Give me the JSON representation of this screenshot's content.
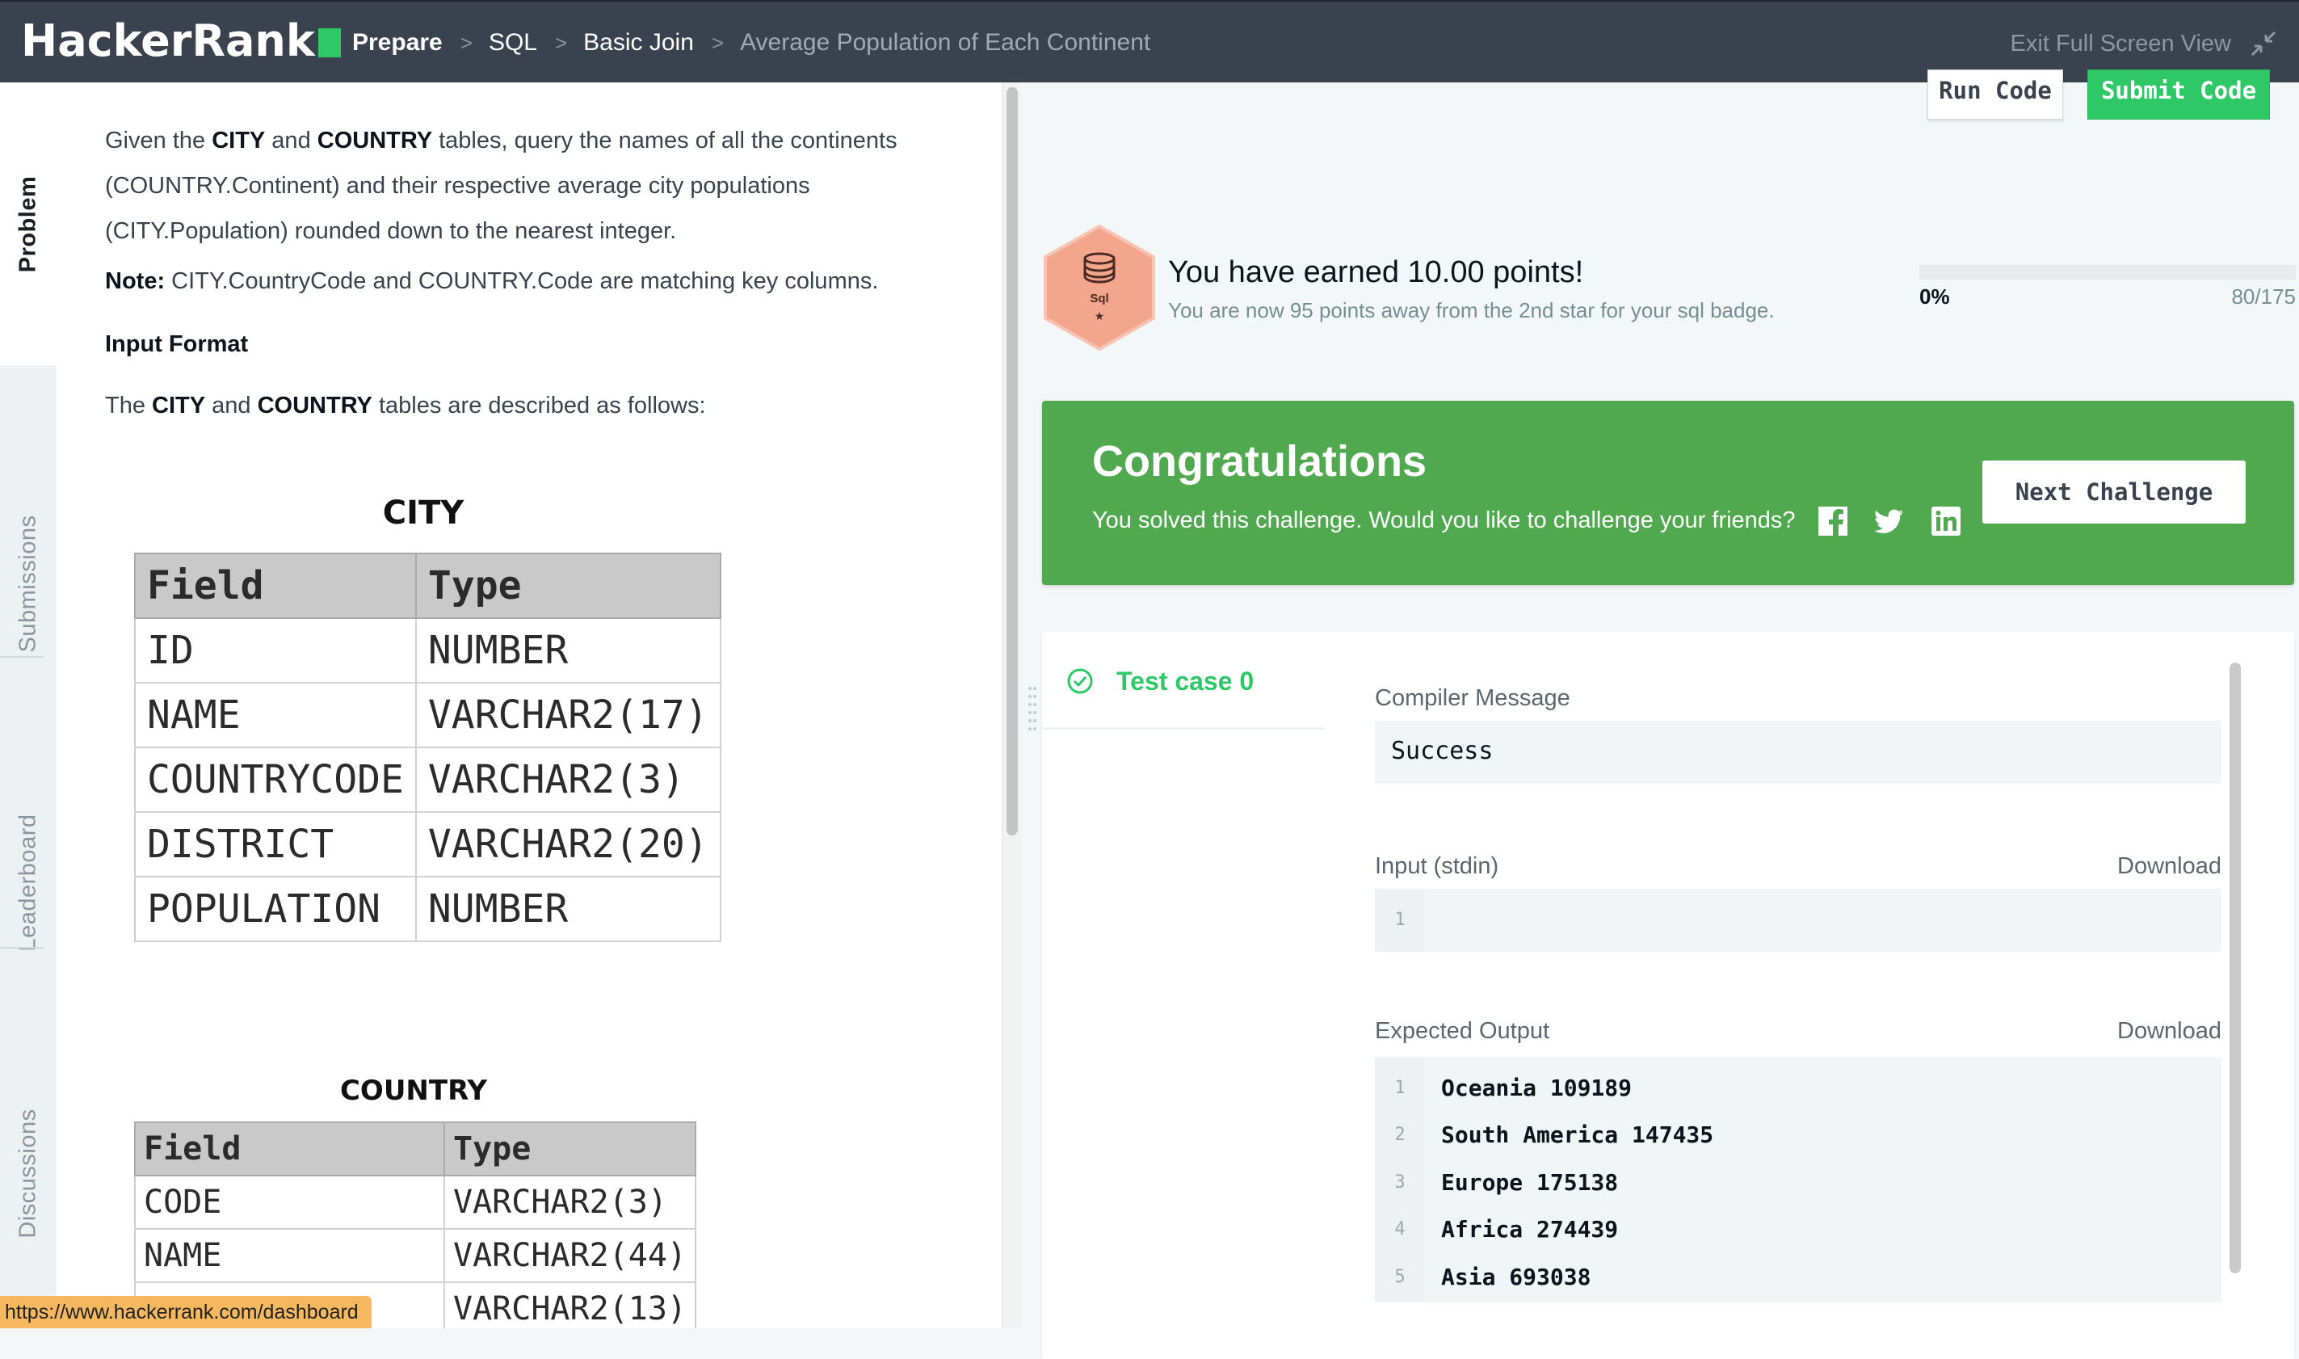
{
  "topbar": {
    "logo": "HackerRank",
    "breadcrumbs": [
      "Prepare",
      "SQL",
      "Basic Join",
      "Average Population of Each Continent"
    ],
    "exit_label": "Exit Full Screen View"
  },
  "rail": {
    "tabs": [
      "Problem",
      "Submissions",
      "Leaderboard",
      "Discussions"
    ]
  },
  "problem": {
    "p1_a": "Given the ",
    "p1_city": "CITY",
    "p1_b": " and ",
    "p1_country": "COUNTRY",
    "p1_c": " tables, query the names of all the continents",
    "p1_line2": "(COUNTRY.Continent) and their respective average city populations",
    "p1_line3": "(CITY.Population) rounded down to the nearest integer.",
    "note_label": "Note:",
    "note_text": " CITY.CountryCode and COUNTRY.Code are matching key columns.",
    "input_format": "Input Format",
    "desc_a": "The ",
    "desc_city": "CITY",
    "desc_b": " and ",
    "desc_country": "COUNTRY",
    "desc_c": " tables are described as follows:"
  },
  "city_table": {
    "title": "CITY",
    "headers": [
      "Field",
      "Type"
    ],
    "rows": [
      [
        "ID",
        "NUMBER"
      ],
      [
        "NAME",
        "VARCHAR2(17)"
      ],
      [
        "COUNTRYCODE",
        "VARCHAR2(3)"
      ],
      [
        "DISTRICT",
        "VARCHAR2(20)"
      ],
      [
        "POPULATION",
        "NUMBER"
      ]
    ]
  },
  "country_table": {
    "title": "COUNTRY",
    "headers": [
      "Field",
      "Type"
    ],
    "rows": [
      [
        "CODE",
        "VARCHAR2(3)"
      ],
      [
        "NAME",
        "VARCHAR2(44)"
      ],
      [
        "",
        "VARCHAR2(13)"
      ]
    ]
  },
  "actions": {
    "run_label": "Run Code",
    "submit_label": "Submit Code"
  },
  "points": {
    "badge_label": "Sql",
    "badge_star": "★",
    "title": "You have earned 10.00 points!",
    "subtitle": "You are now 95 points away from the 2nd star for your sql badge.",
    "progress_start": "0%",
    "progress_end": "80/175",
    "progress_fraction": 0
  },
  "congrats": {
    "title": "Congratulations",
    "subtitle": "You solved this challenge. Would you like to challenge your friends?",
    "next_label": "Next Challenge"
  },
  "results": {
    "test_case_label": "Test case 0",
    "compiler_label": "Compiler Message",
    "compiler_value": "Success",
    "input_label": "Input (stdin)",
    "input_download": "Download",
    "input_lines": [
      "1"
    ],
    "expected_label": "Expected Output",
    "expected_download": "Download",
    "expected_line_numbers": [
      "1",
      "2",
      "3",
      "4",
      "5"
    ],
    "expected_lines": [
      "Oceania 109189",
      "South America 147435",
      "Europe 175138",
      "Africa 274439",
      "Asia 693038"
    ]
  },
  "status_url": "https://www.hackerrank.com/dashboard",
  "colors": {
    "topbar": "#39424e",
    "brand_green": "#2ec866",
    "congrats_green": "#50a84f",
    "badge": "#f4a68d"
  },
  "icons": [
    "minimize-icon",
    "facebook-icon",
    "twitter-icon",
    "linkedin-icon",
    "check-circle-icon",
    "database-icon"
  ]
}
